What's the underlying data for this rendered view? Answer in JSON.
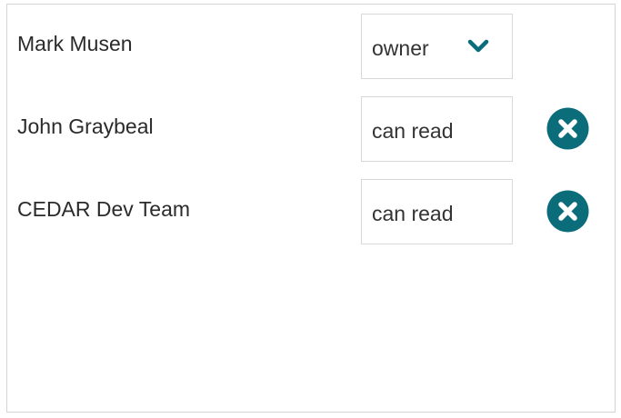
{
  "colors": {
    "accent": "#0b6c7a",
    "border": "#d8d8d8",
    "text": "#2b2b2b"
  },
  "shares": [
    {
      "name": "Mark Musen",
      "permission": "owner",
      "permission_icon": "chevron-down-icon",
      "removable": false
    },
    {
      "name": "John Graybeal",
      "permission": "can read",
      "remove_icon": "close-circle-icon",
      "removable": true
    },
    {
      "name": "CEDAR Dev Team",
      "permission": "can read",
      "remove_icon": "close-circle-icon",
      "removable": true
    }
  ]
}
